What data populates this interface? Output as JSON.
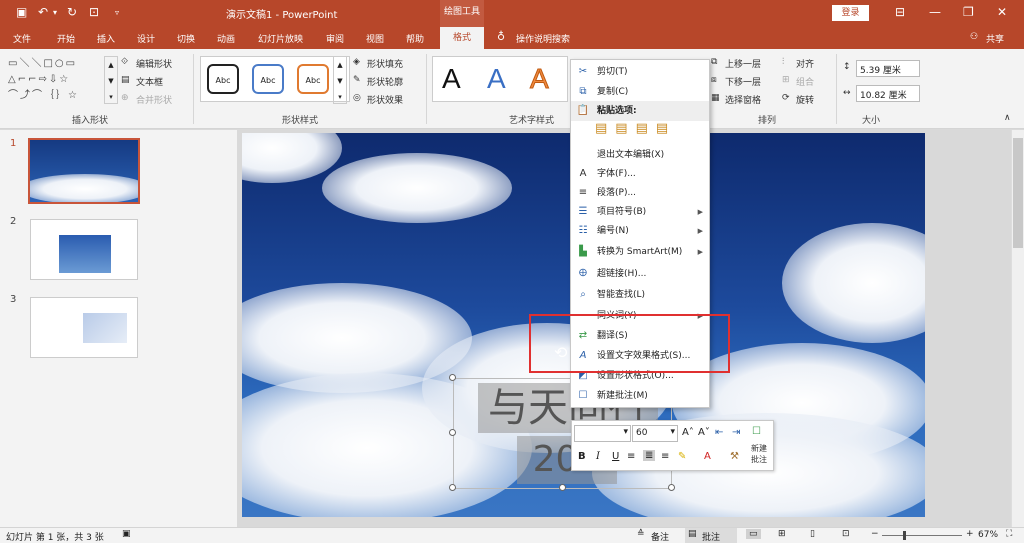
{
  "window": {
    "title": "演示文稿1 - PowerPoint",
    "context_label": "绘图工具",
    "login": "登录",
    "share": "共享"
  },
  "tabs": [
    "文件",
    "开始",
    "插入",
    "设计",
    "切换",
    "动画",
    "幻灯片放映",
    "审阅",
    "视图",
    "帮助",
    "格式"
  ],
  "tell_me": "操作说明搜索",
  "ribbon": {
    "groups": [
      "插入形状",
      "形状样式",
      "艺术字样式",
      "排列",
      "大小"
    ],
    "edit_shape": "编辑形状",
    "text_box": "文本框",
    "merge_shapes": "合并形状",
    "shape_fill": "形状填充",
    "shape_outline": "形状轮廓",
    "shape_effects": "形状效果",
    "style_label": "Abc",
    "wordart_glyph": "A",
    "bring_forward": "上移一层",
    "send_backward": "下移一层",
    "selection_pane": "选择窗格",
    "align": "对齐",
    "group": "组合",
    "rotate": "旋转",
    "height": "5.39 厘米",
    "width": "10.82 厘米"
  },
  "slides": [
    {
      "number": "1"
    },
    {
      "number": "2"
    },
    {
      "number": "3"
    }
  ],
  "context_menu": {
    "items": [
      {
        "label": "剪切(T)",
        "icon": "scissors-icon"
      },
      {
        "label": "复制(C)",
        "icon": "copy-icon"
      },
      {
        "label": "粘贴选项:",
        "icon": "paste-icon"
      },
      {
        "label": "退出文本编辑(X)",
        "icon": ""
      },
      {
        "label": "字体(F)...",
        "icon": "font-icon"
      },
      {
        "label": "段落(P)...",
        "icon": "paragraph-icon"
      },
      {
        "label": "项目符号(B)",
        "icon": "bullets-icon",
        "submenu": true
      },
      {
        "label": "编号(N)",
        "icon": "numbering-icon",
        "submenu": true
      },
      {
        "label": "转换为 SmartArt(M)",
        "icon": "smartart-icon",
        "submenu": true
      },
      {
        "label": "超链接(H)...",
        "icon": "hyperlink-icon"
      },
      {
        "label": "智能查找(L)",
        "icon": "smart-lookup-icon"
      },
      {
        "label": "同义词(Y)",
        "icon": "",
        "submenu": true
      },
      {
        "label": "翻译(S)",
        "icon": "translate-icon"
      },
      {
        "label": "设置文字效果格式(S)...",
        "icon": "text-effects-icon"
      },
      {
        "label": "设置形状格式(O)...",
        "icon": "shape-format-icon"
      },
      {
        "label": "新建批注(M)",
        "icon": "comment-icon"
      }
    ]
  },
  "mini_toolbar": {
    "font_size": "60",
    "new_comment": "新建\n批注",
    "bold": "B",
    "italic": "I",
    "underline": "U"
  },
  "slide_text": {
    "line1": "与天同行",
    "line2": "202"
  },
  "status": {
    "slide_info": "幻灯片 第 1 张，共 3 张",
    "notes": "备注",
    "comments": "批注",
    "zoom": "67%"
  },
  "colors": {
    "accent": "#b7472a",
    "highlight": "#e03030"
  }
}
